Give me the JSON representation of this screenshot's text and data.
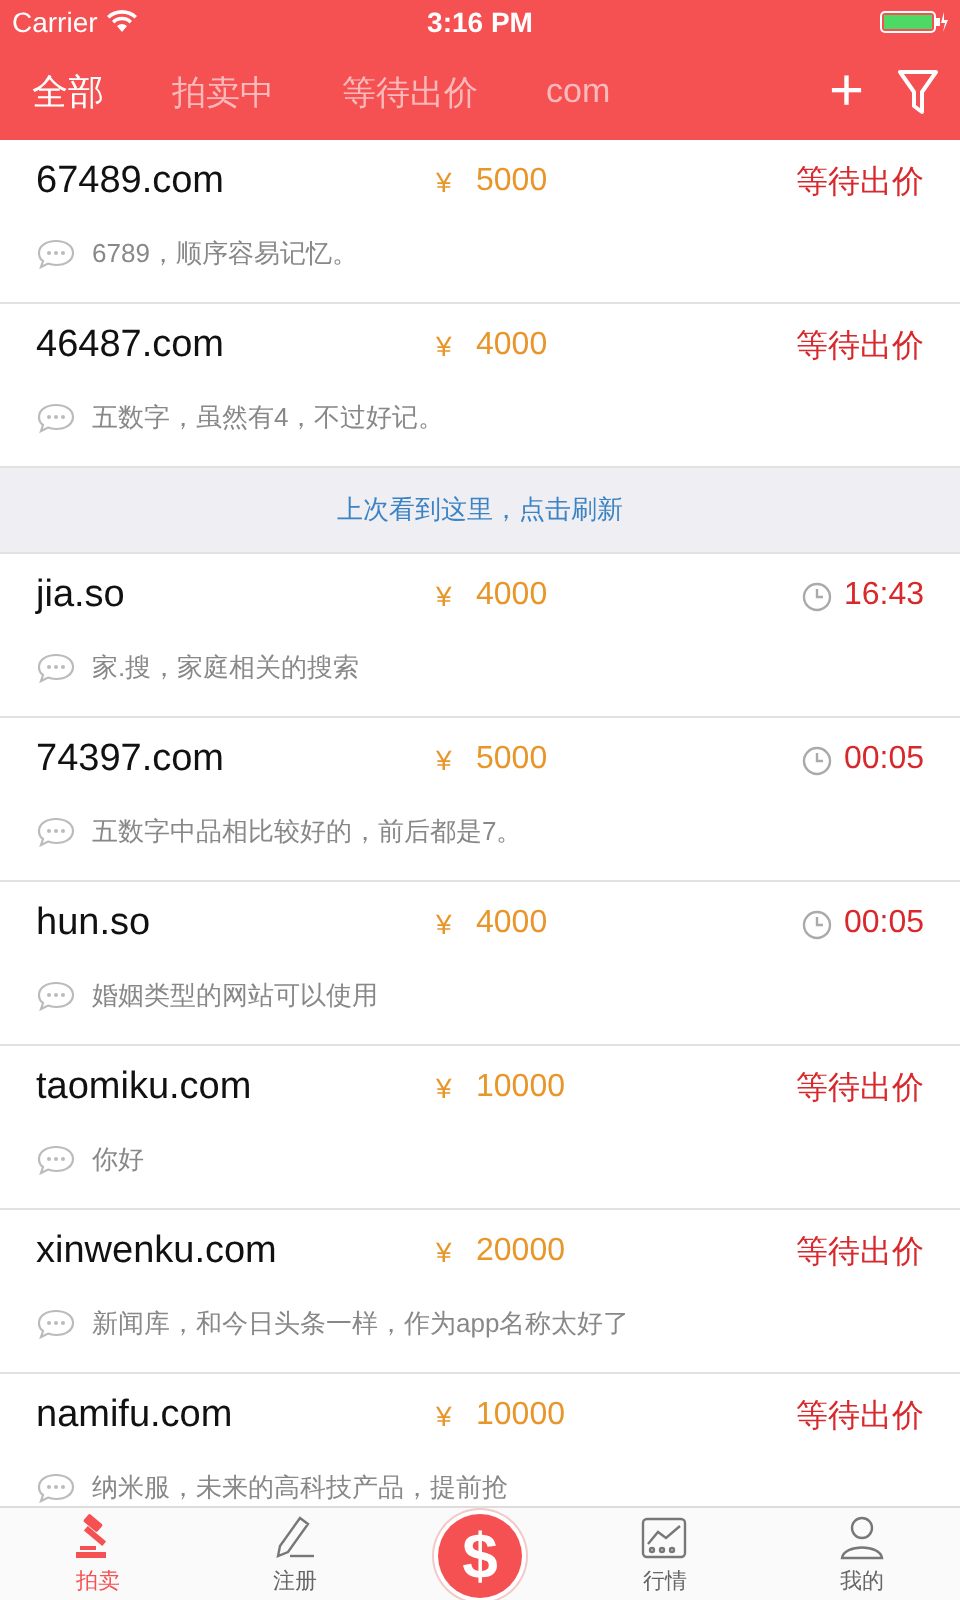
{
  "status_bar": {
    "carrier": "Carrier",
    "time": "3:16 PM"
  },
  "filter_tabs": [
    {
      "label": "全部",
      "selected": true
    },
    {
      "label": "拍卖中",
      "selected": false
    },
    {
      "label": "等待出价",
      "selected": false
    },
    {
      "label": "com",
      "selected": false
    }
  ],
  "add_button": "+",
  "listings": [
    {
      "domain": "67489.com",
      "currency": "¥",
      "price": "5000",
      "kind": "waiting",
      "status": "等待出价",
      "note": "6789，顺序容易记忆。"
    },
    {
      "domain": "46487.com",
      "currency": "¥",
      "price": "4000",
      "kind": "waiting",
      "status": "等待出价",
      "note": "五数字，虽然有4，不过好记。"
    },
    {
      "kind": "refresh",
      "text": "上次看到这里，点击刷新"
    },
    {
      "domain": "jia.so",
      "currency": "¥",
      "price": "4000",
      "kind": "countdown",
      "status": "16:43",
      "note": "家.搜，家庭相关的搜索"
    },
    {
      "domain": "74397.com",
      "currency": "¥",
      "price": "5000",
      "kind": "countdown",
      "status": "00:05",
      "note": "五数字中品相比较好的，前后都是7。"
    },
    {
      "domain": "hun.so",
      "currency": "¥",
      "price": "4000",
      "kind": "countdown",
      "status": "00:05",
      "note": "婚姻类型的网站可以使用"
    },
    {
      "domain": "taomiku.com",
      "currency": "¥",
      "price": "10000",
      "kind": "waiting",
      "status": "等待出价",
      "note": "你好"
    },
    {
      "domain": "xinwenku.com",
      "currency": "¥",
      "price": "20000",
      "kind": "waiting",
      "status": "等待出价",
      "note": "新闻库，和今日头条一样，作为app名称太好了"
    },
    {
      "domain": "namifu.com",
      "currency": "¥",
      "price": "10000",
      "kind": "waiting",
      "status": "等待出价",
      "note": "纳米服，未来的高科技产品，提前抢"
    }
  ],
  "bottom_tabs": [
    {
      "label": "拍卖",
      "kind": "auction",
      "selected": true
    },
    {
      "label": "注册",
      "kind": "register",
      "selected": false
    },
    {
      "label": "$",
      "kind": "center",
      "selected": false
    },
    {
      "label": "行情",
      "kind": "market",
      "selected": false
    },
    {
      "label": "我的",
      "kind": "profile",
      "selected": false
    }
  ]
}
